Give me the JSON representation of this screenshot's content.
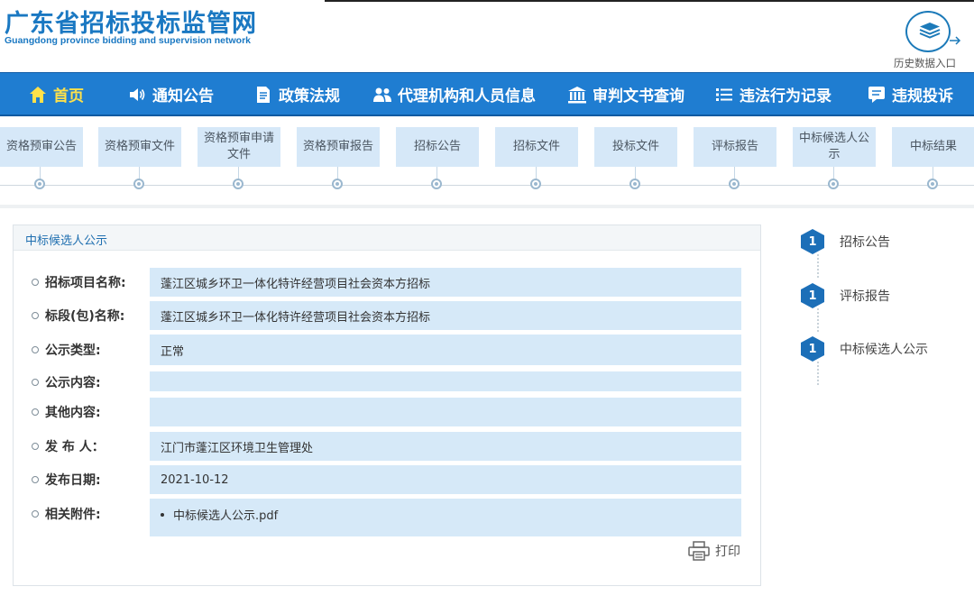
{
  "header": {
    "title": "广东省招标投标监管网",
    "subtitle": "Guangdong province bidding and supervision network",
    "history_label": "历史数据入口"
  },
  "nav": {
    "items": [
      {
        "label": "首页",
        "icon": "home-icon",
        "active": true
      },
      {
        "label": "通知公告",
        "icon": "speaker-icon"
      },
      {
        "label": "政策法规",
        "icon": "document-icon"
      },
      {
        "label": "代理机构和人员信息",
        "icon": "people-icon"
      },
      {
        "label": "审判文书查询",
        "icon": "courthouse-icon"
      },
      {
        "label": "违法行为记录",
        "icon": "list-icon"
      },
      {
        "label": "违规投诉",
        "icon": "complaint-icon"
      }
    ]
  },
  "steps": [
    "资格预审公告",
    "资格预审文件",
    "资格预审申请文件",
    "资格预审报告",
    "招标公告",
    "招标文件",
    "投标文件",
    "评标报告",
    "中标候选人公示",
    "中标结果"
  ],
  "panel": {
    "title": "中标候选人公示",
    "rows": [
      {
        "label": "招标项目名称:",
        "value": "蓬江区城乡环卫一体化特许经营项目社会资本方招标"
      },
      {
        "label": "标段(包)名称:",
        "value": "蓬江区城乡环卫一体化特许经营项目社会资本方招标"
      },
      {
        "label": "公示类型:",
        "value": "正常"
      },
      {
        "label": "公示内容:",
        "value": ""
      },
      {
        "label": "其他内容:",
        "value": ""
      },
      {
        "label": "发 布 人：",
        "value": "江门市蓬江区环境卫生管理处"
      },
      {
        "label": "发布日期:",
        "value": "2021-10-12"
      },
      {
        "label": "相关附件:",
        "value": "中标候选人公示.pdf"
      }
    ],
    "print_label": "打印"
  },
  "timeline": [
    {
      "badge": "1",
      "label": "招标公告"
    },
    {
      "badge": "1",
      "label": "评标报告"
    },
    {
      "badge": "1",
      "label": "中标候选人公示"
    }
  ],
  "colors": {
    "nav_bg": "#1f7dd1",
    "nav_active": "#ffe14a",
    "value_bg": "#d6e9f8",
    "brand": "#1a78c2"
  }
}
